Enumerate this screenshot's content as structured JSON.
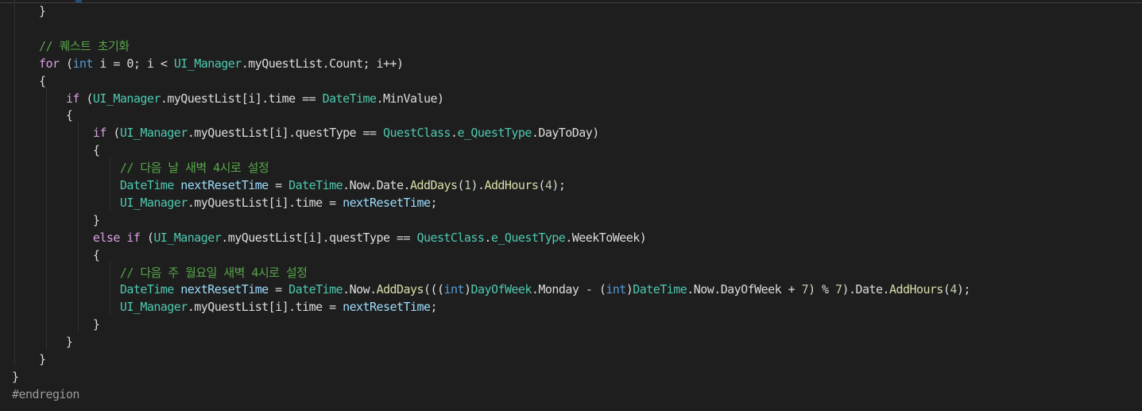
{
  "editor": {
    "language": "C#",
    "colors": {
      "background": "#1e1e1e",
      "keyword": "#569cd6",
      "control_keyword": "#d8a0df",
      "type": "#4ec9b0",
      "field": "#9cdcfe",
      "method": "#dcdcaa",
      "number": "#b5cea8",
      "comment": "#57a64a",
      "preprocessor": "#9b9b9b",
      "text": "#dcdcdc"
    },
    "lines": [
      {
        "tokens": [
          {
            "t": "    }",
            "c": "txt"
          }
        ]
      },
      {
        "tokens": []
      },
      {
        "tokens": [
          {
            "t": "    // 퀘스트 초기화",
            "c": "com"
          }
        ]
      },
      {
        "tokens": [
          {
            "t": "    ",
            "c": "txt"
          },
          {
            "t": "for",
            "c": "ctl"
          },
          {
            "t": " (",
            "c": "txt"
          },
          {
            "t": "int",
            "c": "kw"
          },
          {
            "t": " i = 0; i < ",
            "c": "txt"
          },
          {
            "t": "UI_Manager",
            "c": "type"
          },
          {
            "t": ".myQuestList.Count; i++)",
            "c": "txt"
          }
        ]
      },
      {
        "tokens": [
          {
            "t": "    {",
            "c": "txt"
          }
        ]
      },
      {
        "tokens": [
          {
            "t": "        ",
            "c": "txt"
          },
          {
            "t": "if",
            "c": "ctl"
          },
          {
            "t": " (",
            "c": "txt"
          },
          {
            "t": "UI_Manager",
            "c": "type"
          },
          {
            "t": ".myQuestList[i].time == ",
            "c": "txt"
          },
          {
            "t": "DateTime",
            "c": "type"
          },
          {
            "t": ".MinValue)",
            "c": "txt"
          }
        ]
      },
      {
        "tokens": [
          {
            "t": "        {",
            "c": "txt"
          }
        ]
      },
      {
        "tokens": [
          {
            "t": "            ",
            "c": "txt"
          },
          {
            "t": "if",
            "c": "ctl"
          },
          {
            "t": " (",
            "c": "txt"
          },
          {
            "t": "UI_Manager",
            "c": "type"
          },
          {
            "t": ".myQuestList[i].questType == ",
            "c": "txt"
          },
          {
            "t": "QuestClass",
            "c": "type"
          },
          {
            "t": ".",
            "c": "txt"
          },
          {
            "t": "e_QuestType",
            "c": "type"
          },
          {
            "t": ".DayToDay)",
            "c": "txt"
          }
        ]
      },
      {
        "tokens": [
          {
            "t": "            {",
            "c": "txt"
          }
        ]
      },
      {
        "tokens": [
          {
            "t": "                // 다음 날 새벽 4시로 설정",
            "c": "com"
          }
        ]
      },
      {
        "tokens": [
          {
            "t": "                ",
            "c": "txt"
          },
          {
            "t": "DateTime",
            "c": "type"
          },
          {
            "t": " ",
            "c": "txt"
          },
          {
            "t": "nextResetTime",
            "c": "var"
          },
          {
            "t": " = ",
            "c": "txt"
          },
          {
            "t": "DateTime",
            "c": "type"
          },
          {
            "t": ".Now.Date.",
            "c": "txt"
          },
          {
            "t": "AddDays",
            "c": "meth"
          },
          {
            "t": "(",
            "c": "txt"
          },
          {
            "t": "1",
            "c": "num"
          },
          {
            "t": ").",
            "c": "txt"
          },
          {
            "t": "AddHours",
            "c": "meth"
          },
          {
            "t": "(",
            "c": "txt"
          },
          {
            "t": "4",
            "c": "num"
          },
          {
            "t": ");",
            "c": "txt"
          }
        ]
      },
      {
        "tokens": [
          {
            "t": "                ",
            "c": "txt"
          },
          {
            "t": "UI_Manager",
            "c": "type"
          },
          {
            "t": ".myQuestList[i].time = ",
            "c": "txt"
          },
          {
            "t": "nextResetTime",
            "c": "var"
          },
          {
            "t": ";",
            "c": "txt"
          }
        ]
      },
      {
        "tokens": [
          {
            "t": "            }",
            "c": "txt"
          }
        ]
      },
      {
        "tokens": [
          {
            "t": "            ",
            "c": "txt"
          },
          {
            "t": "else if",
            "c": "ctl"
          },
          {
            "t": " (",
            "c": "txt"
          },
          {
            "t": "UI_Manager",
            "c": "type"
          },
          {
            "t": ".myQuestList[i].questType == ",
            "c": "txt"
          },
          {
            "t": "QuestClass",
            "c": "type"
          },
          {
            "t": ".",
            "c": "txt"
          },
          {
            "t": "e_QuestType",
            "c": "type"
          },
          {
            "t": ".WeekToWeek)",
            "c": "txt"
          }
        ]
      },
      {
        "tokens": [
          {
            "t": "            {",
            "c": "txt"
          }
        ]
      },
      {
        "tokens": [
          {
            "t": "                // 다음 주 월요일 새벽 4시로 설정",
            "c": "com"
          }
        ]
      },
      {
        "tokens": [
          {
            "t": "                ",
            "c": "txt"
          },
          {
            "t": "DateTime",
            "c": "type"
          },
          {
            "t": " ",
            "c": "txt"
          },
          {
            "t": "nextResetTime",
            "c": "var"
          },
          {
            "t": " = ",
            "c": "txt"
          },
          {
            "t": "DateTime",
            "c": "type"
          },
          {
            "t": ".Now.",
            "c": "txt"
          },
          {
            "t": "AddDays",
            "c": "meth"
          },
          {
            "t": "(((",
            "c": "txt"
          },
          {
            "t": "int",
            "c": "kw"
          },
          {
            "t": ")",
            "c": "txt"
          },
          {
            "t": "DayOfWeek",
            "c": "type"
          },
          {
            "t": ".Monday - (",
            "c": "txt"
          },
          {
            "t": "int",
            "c": "kw"
          },
          {
            "t": ")",
            "c": "txt"
          },
          {
            "t": "DateTime",
            "c": "type"
          },
          {
            "t": ".Now.DayOfWeek + ",
            "c": "txt"
          },
          {
            "t": "7",
            "c": "num"
          },
          {
            "t": ") % ",
            "c": "txt"
          },
          {
            "t": "7",
            "c": "num"
          },
          {
            "t": ").Date.",
            "c": "txt"
          },
          {
            "t": "AddHours",
            "c": "meth"
          },
          {
            "t": "(",
            "c": "txt"
          },
          {
            "t": "4",
            "c": "num"
          },
          {
            "t": ");",
            "c": "txt"
          }
        ]
      },
      {
        "tokens": [
          {
            "t": "                ",
            "c": "txt"
          },
          {
            "t": "UI_Manager",
            "c": "type"
          },
          {
            "t": ".myQuestList[i].time = ",
            "c": "txt"
          },
          {
            "t": "nextResetTime",
            "c": "var"
          },
          {
            "t": ";",
            "c": "txt"
          }
        ]
      },
      {
        "tokens": [
          {
            "t": "            }",
            "c": "txt"
          }
        ]
      },
      {
        "tokens": [
          {
            "t": "        }",
            "c": "txt"
          }
        ]
      },
      {
        "tokens": [
          {
            "t": "    }",
            "c": "txt"
          }
        ]
      },
      {
        "tokens": [
          {
            "t": "}",
            "c": "txt"
          }
        ]
      },
      {
        "tokens": [
          {
            "t": "#endregion",
            "c": "pre"
          }
        ]
      }
    ]
  }
}
